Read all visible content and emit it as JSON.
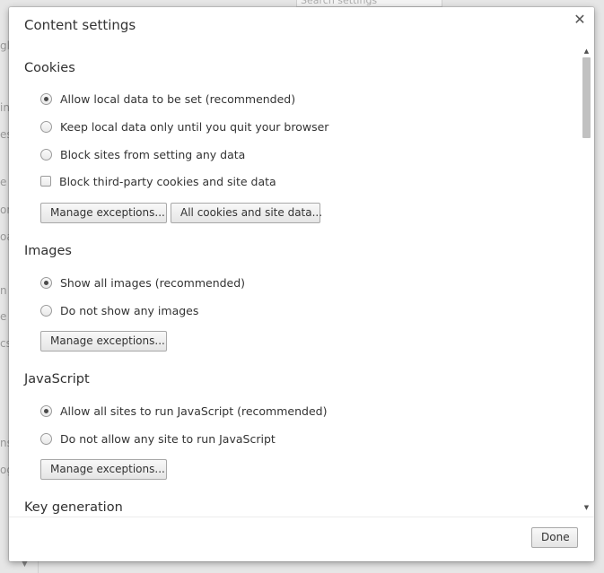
{
  "background": {
    "search_placeholder": "Search settings",
    "fragments": [
      "gl",
      "in",
      "es",
      "e n",
      "on",
      "oa",
      "n c",
      "e s",
      "cs",
      "ns",
      "og"
    ]
  },
  "dialog": {
    "title": "Content settings",
    "close_glyph": "✕",
    "done_label": "Done"
  },
  "sections": {
    "cookies": {
      "title": "Cookies",
      "options": [
        {
          "label": "Allow local data to be set (recommended)",
          "checked": true
        },
        {
          "label": "Keep local data only until you quit your browser",
          "checked": false
        },
        {
          "label": "Block sites from setting any data",
          "checked": false
        }
      ],
      "checkbox": {
        "label": "Block third-party cookies and site data",
        "checked": false
      },
      "manage_label": "Manage exceptions...",
      "all_cookies_label": "All cookies and site data..."
    },
    "images": {
      "title": "Images",
      "options": [
        {
          "label": "Show all images (recommended)",
          "checked": true
        },
        {
          "label": "Do not show any images",
          "checked": false
        }
      ],
      "manage_label": "Manage exceptions..."
    },
    "javascript": {
      "title": "JavaScript",
      "options": [
        {
          "label": "Allow all sites to run JavaScript (recommended)",
          "checked": true
        },
        {
          "label": "Do not allow any site to run JavaScript",
          "checked": false
        }
      ],
      "manage_label": "Manage exceptions..."
    },
    "key_generation": {
      "title": "Key generation"
    }
  },
  "scrollbar": {
    "up_glyph": "▲",
    "down_glyph": "▼"
  }
}
